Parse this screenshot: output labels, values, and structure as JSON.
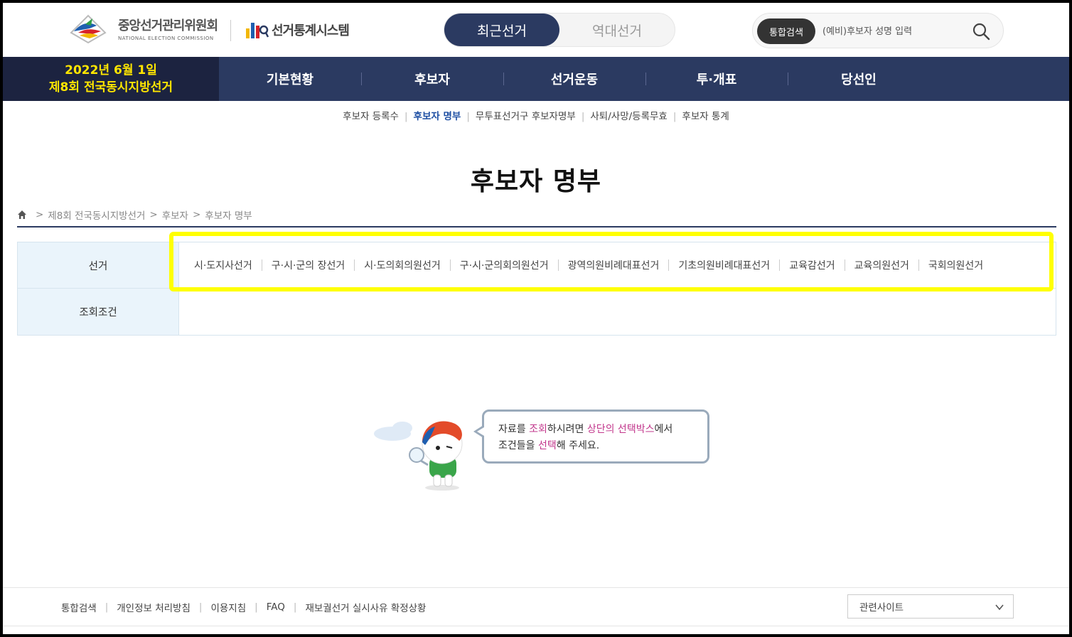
{
  "header": {
    "nec_logo_name": "중앙선거관리위원회",
    "nec_logo_sub": "NATIONAL ELECTION COMMISSION",
    "stat_logo_name": "선거통계시스템",
    "toggle": {
      "active": "최근선거",
      "inactive": "역대선거"
    },
    "search": {
      "tag": "통합검색",
      "placeholder": "(예비)후보자 성명 입력"
    }
  },
  "nav": {
    "election_badge_line1": "2022년 6월 1일",
    "election_badge_line2": "제8회 전국동시지방선거",
    "menu": [
      "기본현황",
      "후보자",
      "선거운동",
      "투·개표",
      "당선인"
    ]
  },
  "subnav": {
    "items": [
      "후보자 등록수",
      "후보자 명부",
      "무투표선거구 후보자명부",
      "사퇴/사망/등록무효",
      "후보자 통계"
    ],
    "active_index": 1
  },
  "page_title": "후보자 명부",
  "breadcrumb": [
    "제8회 전국동시지방선거",
    "후보자",
    "후보자 명부"
  ],
  "filter": {
    "election_label": "선거",
    "condition_label": "조회조건",
    "elections": [
      "시·도지사선거",
      "구·시·군의 장선거",
      "시·도의회의원선거",
      "구·시·군의회의원선거",
      "광역의원비례대표선거",
      "기초의원비례대표선거",
      "교육감선거",
      "교육의원선거",
      "국회의원선거"
    ]
  },
  "empty_message": {
    "p1": "자료를 ",
    "p2": "조회",
    "p3": "하시려면 ",
    "p4": "상단의 선택박스",
    "p5": "에서",
    "p6": "조건들을 ",
    "p7": "선택",
    "p8": "해 주세요."
  },
  "footer": {
    "links": [
      "통합검색",
      "개인정보 처리방침",
      "이용지침",
      "FAQ",
      "재보궐선거 실시사유 확정상황"
    ],
    "related_sites": "관련사이트"
  },
  "colors": {
    "navy": "#2b3a61",
    "dark_navy": "#1c2340",
    "badge_yellow": "#ffe600",
    "highlight_yellow": "#ffff00",
    "accent_pink": "#c2378c",
    "active_link": "#1e4fa3"
  }
}
